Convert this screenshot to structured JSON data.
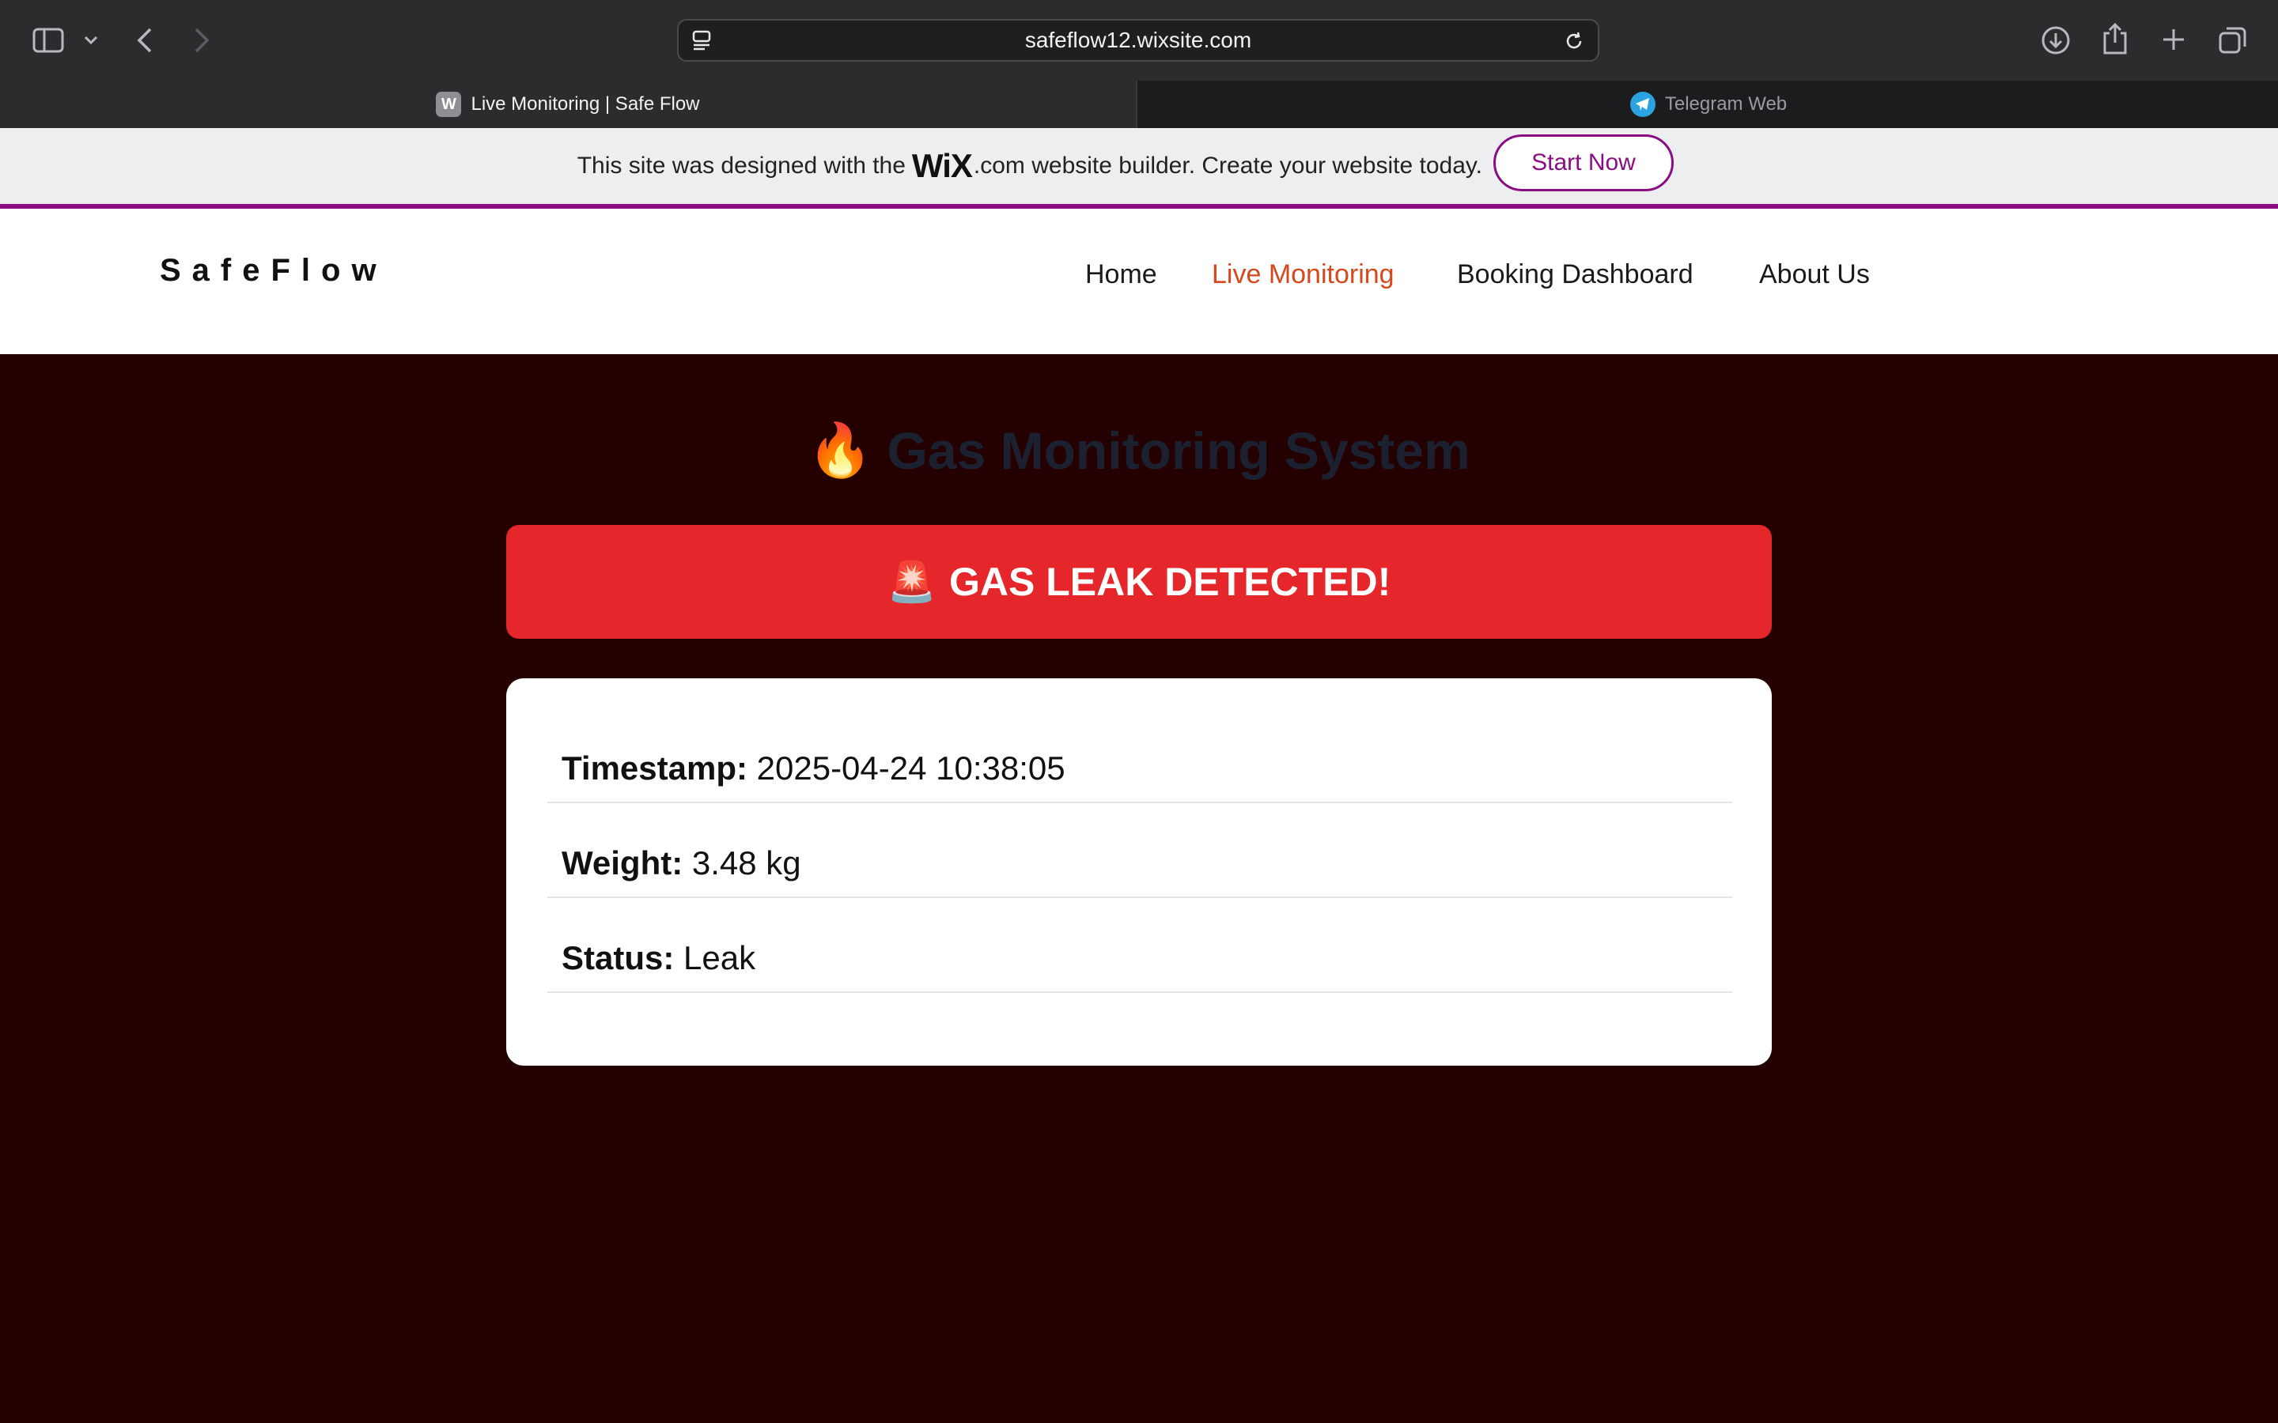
{
  "browser": {
    "url": "safeflow12.wixsite.com",
    "tabs": [
      {
        "title": "Live Monitoring | Safe Flow",
        "favicon": "W",
        "active": true
      },
      {
        "title": "Telegram Web",
        "active": false
      }
    ]
  },
  "wix_banner": {
    "text_before": "This site was designed with the",
    "logo": "WiX",
    "text_after": ".com website builder. Create your website today.",
    "button": "Start Now",
    "accent_color": "#8a0d82"
  },
  "site": {
    "logo": "SafeFlow",
    "nav": [
      {
        "label": "Home",
        "current": false
      },
      {
        "label": "Live Monitoring",
        "current": true
      },
      {
        "label": "Booking Dashboard",
        "current": false
      },
      {
        "label": "About Us",
        "current": false
      }
    ],
    "nav_active_color": "#d4481d"
  },
  "main": {
    "title_emoji": "🔥",
    "title": "Gas Monitoring System",
    "alert_emoji": "🚨",
    "alert": "GAS LEAK DETECTED!",
    "alert_color": "#e5262a",
    "background_color": "#250000",
    "readings": [
      {
        "label": "Timestamp:",
        "value": "2025-04-24 10:38:05"
      },
      {
        "label": "Weight:",
        "value": "3.48 kg"
      },
      {
        "label": "Status:",
        "value": "Leak"
      }
    ]
  }
}
